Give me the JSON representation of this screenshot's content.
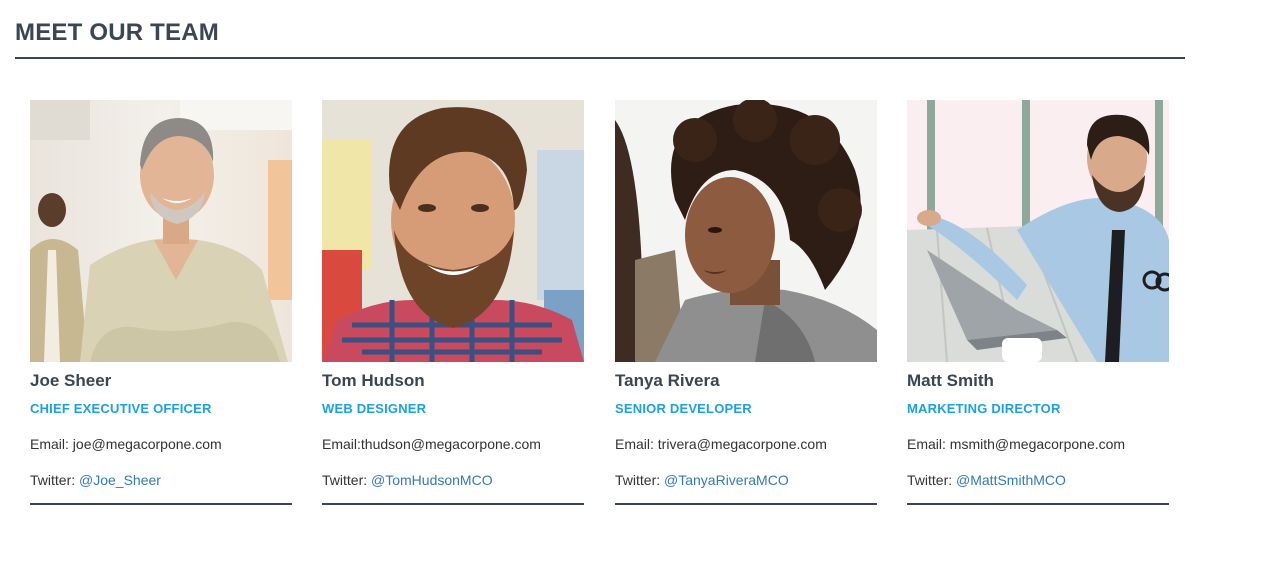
{
  "section": {
    "title": "MEET OUR TEAM"
  },
  "team": [
    {
      "name": "Joe Sheer",
      "role": "CHIEF EXECUTIVE OFFICER",
      "email_label": "Email: ",
      "email": "joe@megacorpone.com",
      "twitter_label": "Twitter: ",
      "twitter": "@Joe_Sheer"
    },
    {
      "name": "Tom Hudson",
      "role": "WEB DESIGNER",
      "email_label": "Email:",
      "email": "thudson@megacorpone.com",
      "twitter_label": "Twitter: ",
      "twitter": "@TomHudsonMCO"
    },
    {
      "name": "Tanya Rivera",
      "role": "SENIOR DEVELOPER",
      "email_label": "Email: ",
      "email": "trivera@megacorpone.com",
      "twitter_label": "Twitter: ",
      "twitter": "@TanyaRiveraMCO"
    },
    {
      "name": "Matt Smith",
      "role": "MARKETING DIRECTOR",
      "email_label": "Email: ",
      "email": "msmith@megacorpone.com",
      "twitter_label": "Twitter: ",
      "twitter": "@MattSmithMCO"
    }
  ],
  "colors": {
    "heading": "#3a4555",
    "role_accent": "#1ba1e2",
    "link": "#337ab7"
  }
}
